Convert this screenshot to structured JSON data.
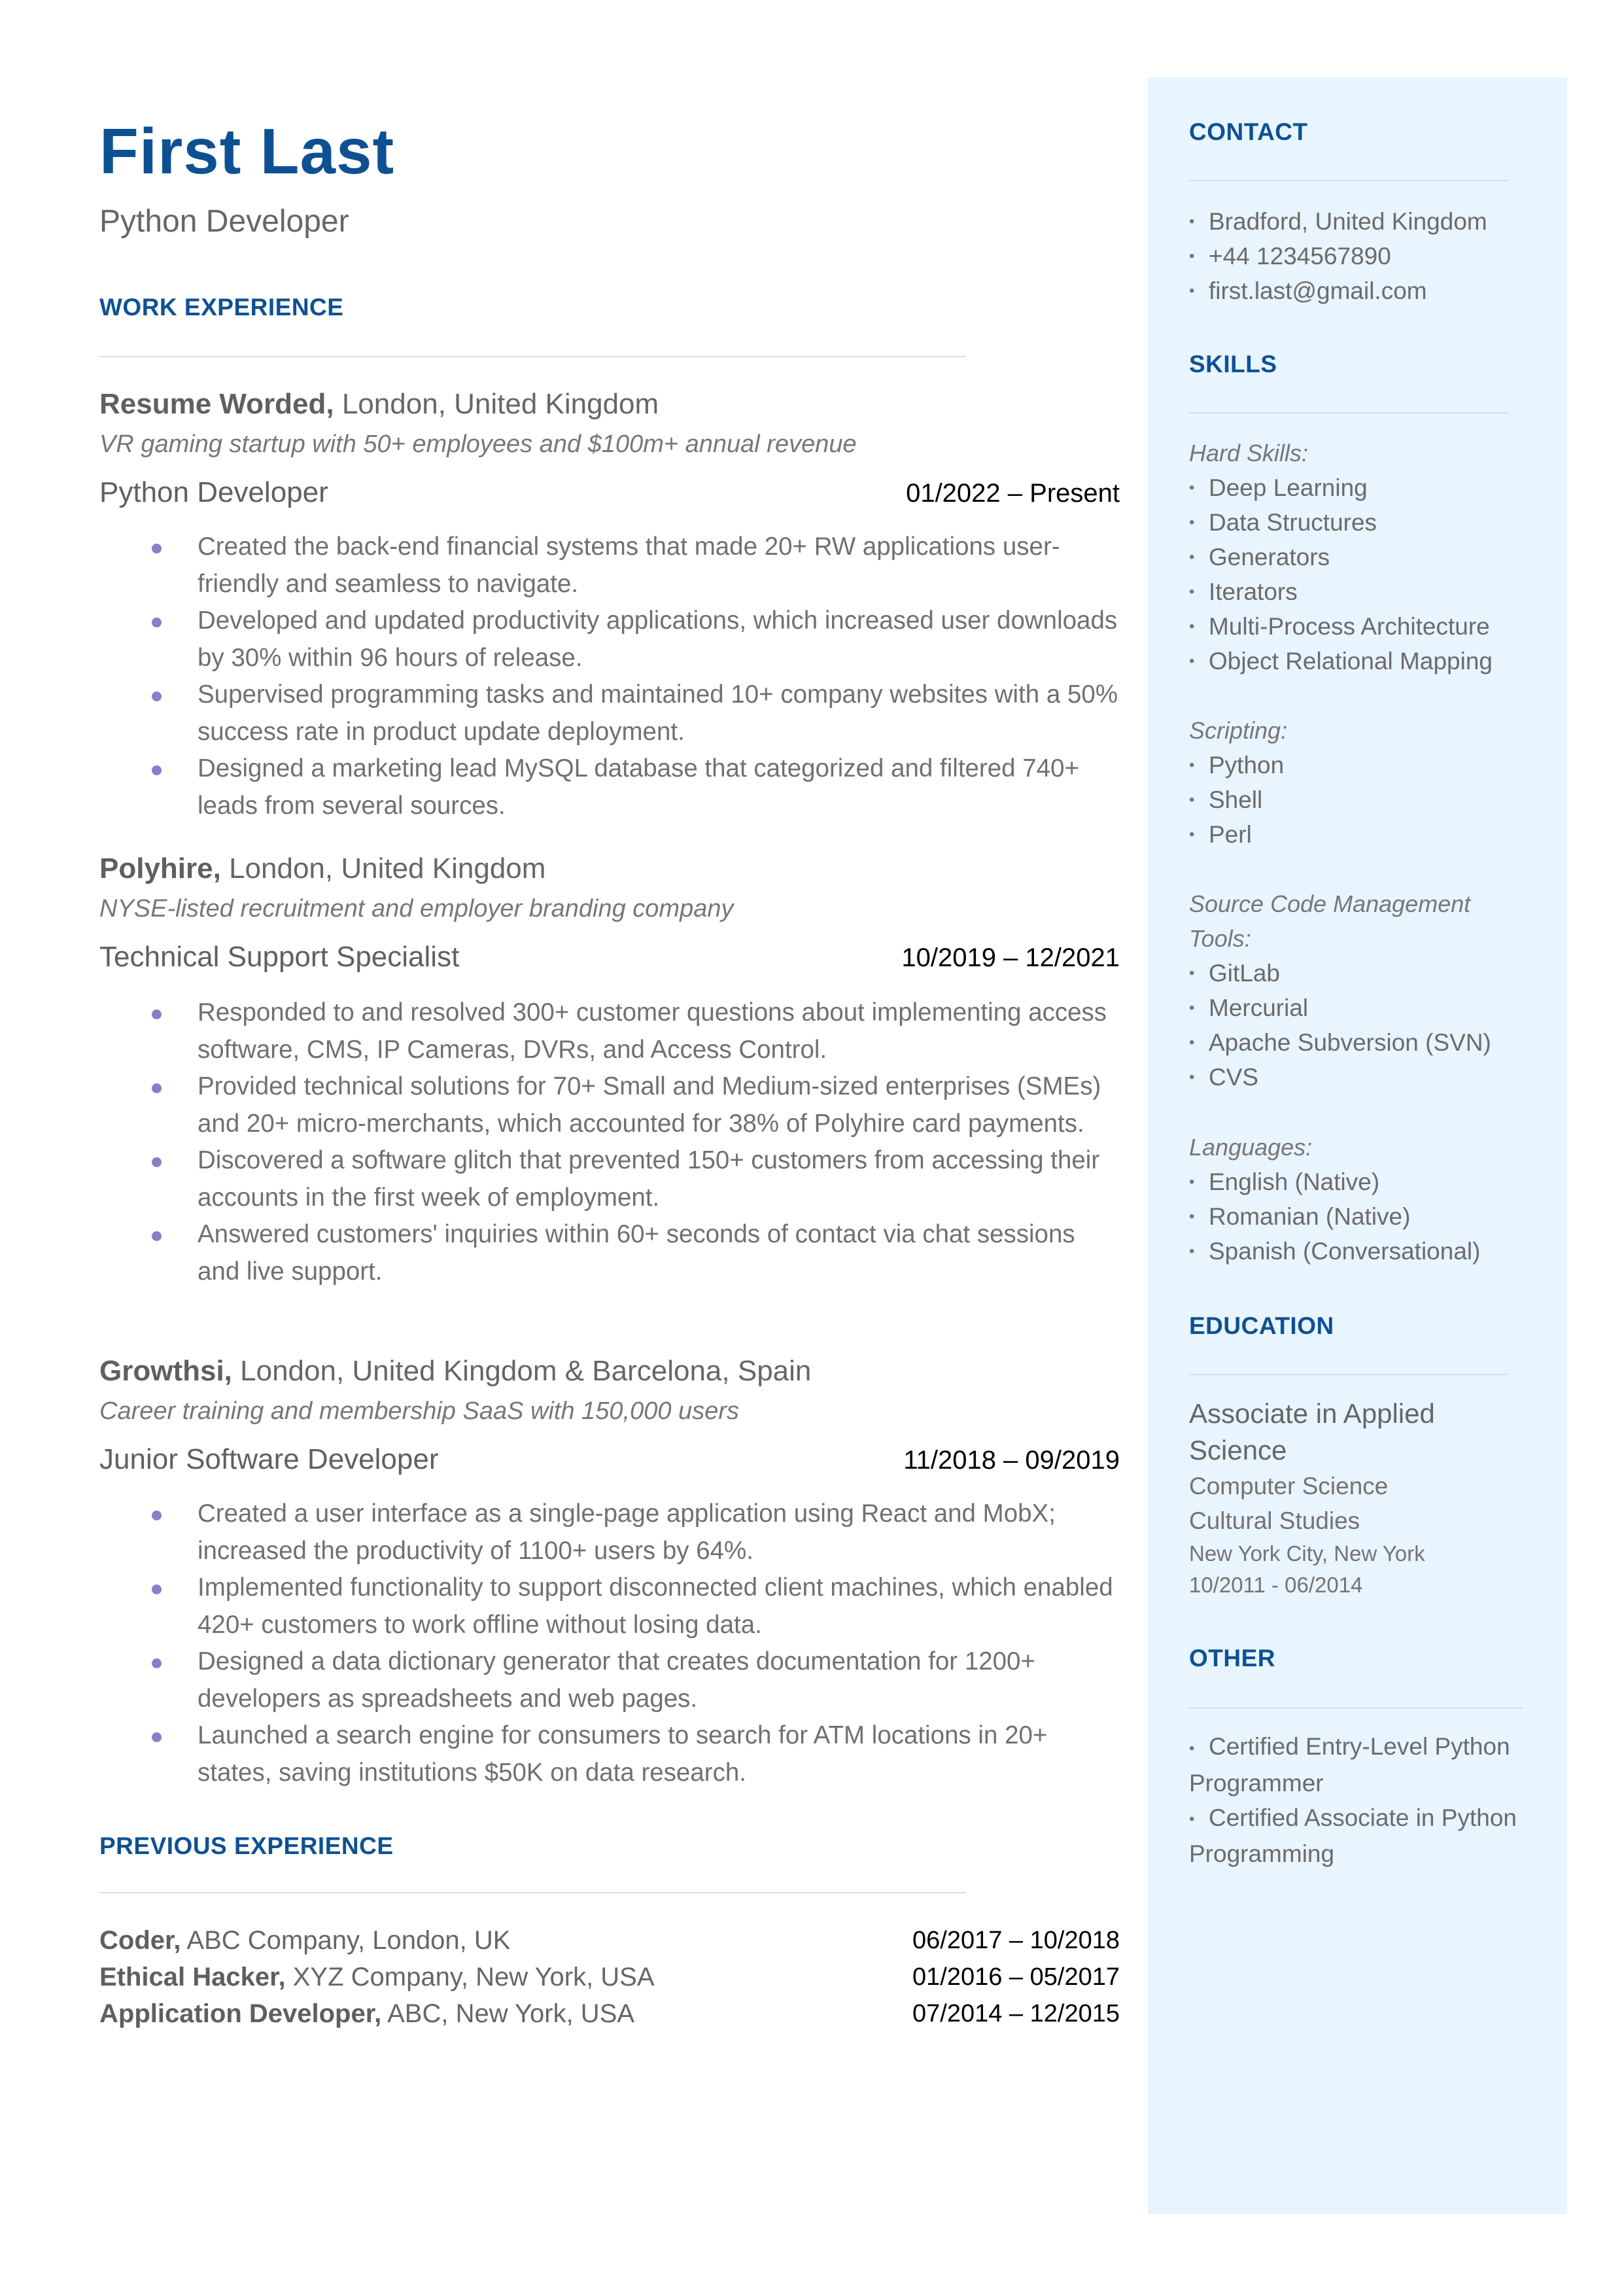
{
  "header": {
    "name": "First Last",
    "title": "Python Developer"
  },
  "colors": {
    "accent": "#0E5193",
    "bullet": "#8C7CCB",
    "sidebar_bg": "#E8F4FE",
    "text": "#666666"
  },
  "work_experience": {
    "heading": "WORK EXPERIENCE",
    "jobs": [
      {
        "company": "Resume Worded,",
        "location": " London, United Kingdom",
        "description": "VR gaming startup with 50+ employees and $100m+ annual revenue",
        "role": "Python Developer",
        "dates": "01/2022 – Present",
        "bullets": [
          "Created the back-end financial systems that made 20+ RW applications user-friendly and seamless to navigate.",
          "Developed and updated productivity applications, which increased user downloads by 30% within 96 hours of release.",
          "Supervised programming tasks and maintained 10+ company websites with a 50% success rate in product update deployment.",
          "Designed a marketing lead MySQL database that categorized and filtered 740+ leads from several sources."
        ]
      },
      {
        "company": "Polyhire,",
        "location": " London, United Kingdom",
        "description": "NYSE-listed recruitment and employer branding company",
        "role": "Technical Support Specialist",
        "dates": "10/2019 – 12/2021",
        "bullets": [
          "Responded to and resolved 300+ customer questions about implementing access software, CMS, IP Cameras, DVRs, and Access Control.",
          "Provided technical solutions for 70+ Small and Medium-sized enterprises (SMEs) and 20+ micro-merchants, which accounted for 38% of Polyhire card payments.",
          "Discovered a software glitch that prevented 150+ customers from accessing their accounts in the first week of employment.",
          "Answered customers' inquiries within 60+ seconds of contact via chat sessions and live support."
        ]
      },
      {
        "company": "Growthsi,",
        "location": " London, United Kingdom & Barcelona, Spain",
        "description": "Career training and membership SaaS with 150,000 users",
        "role": "Junior Software Developer",
        "dates": "11/2018 – 09/2019",
        "bullets": [
          "Created a user interface as a single-page application using React and MobX; increased the productivity of 1100+ users by 64%.",
          "Implemented functionality to support disconnected client machines, which enabled 420+ customers to work offline without losing data.",
          "Designed a data dictionary generator that creates documentation for 1200+ developers as spreadsheets and web pages.",
          "Launched a search engine for consumers to search for ATM locations in 20+ states, saving institutions $50K on data research."
        ]
      }
    ]
  },
  "previous_experience": {
    "heading": "PREVIOUS EXPERIENCE",
    "items": [
      {
        "role": "Coder,",
        "detail": " ABC Company, London, UK",
        "dates": "06/2017 – 10/2018"
      },
      {
        "role": "Ethical Hacker,",
        "detail": " XYZ Company, New York, USA",
        "dates": "01/2016 – 05/2017"
      },
      {
        "role": "Application Developer,",
        "detail": " ABC, New York, USA",
        "dates": "07/2014 – 12/2015"
      }
    ]
  },
  "sidebar": {
    "contact": {
      "heading": "CONTACT",
      "items": [
        "Bradford, United Kingdom",
        "+44 1234567890",
        "first.last@gmail.com"
      ]
    },
    "skills": {
      "heading": "SKILLS",
      "groups": [
        {
          "label": "Hard Skills:",
          "items": [
            "Deep Learning",
            "Data Structures",
            "Generators",
            "Iterators",
            "Multi-Process Architecture",
            "Object Relational Mapping"
          ]
        },
        {
          "label": "Scripting:",
          "items": [
            "Python",
            "Shell",
            "Perl"
          ]
        },
        {
          "label": "Source Code Management Tools:",
          "items": [
            "GitLab",
            "Mercurial",
            "Apache Subversion (SVN)",
            "CVS"
          ]
        },
        {
          "label": "Languages:",
          "items": [
            "English (Native)",
            "Romanian (Native)",
            "Spanish (Conversational)"
          ]
        }
      ]
    },
    "education": {
      "heading": "EDUCATION",
      "degree": "Associate in Applied Science",
      "field": "Computer Science",
      "minor": "Cultural Studies",
      "location": "New York City, New York",
      "dates": "10/2011 - 06/2014"
    },
    "other": {
      "heading": "OTHER",
      "items": [
        "Certified Entry-Level Python Programmer",
        "Certified Associate in Python Programming"
      ]
    }
  }
}
